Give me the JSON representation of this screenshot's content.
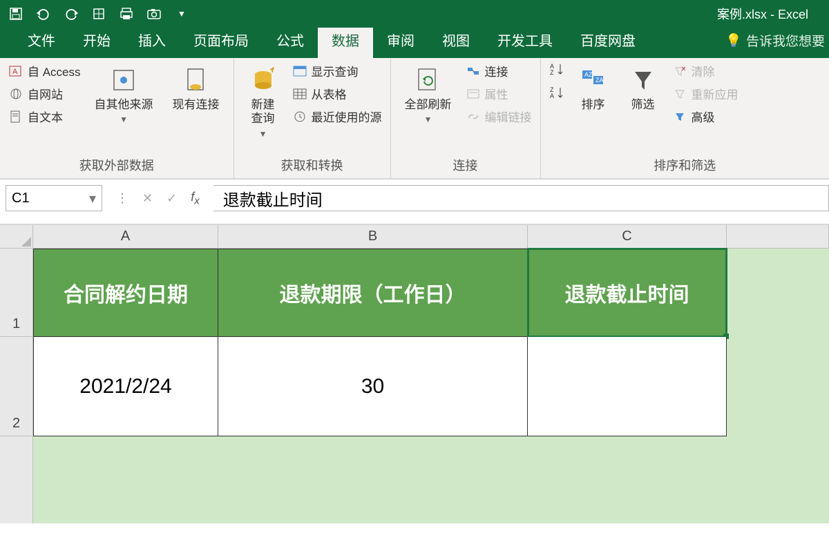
{
  "title": "案例.xlsx - Excel",
  "qat": [
    "save",
    "undo",
    "redo",
    "touch",
    "print",
    "camera"
  ],
  "tabs": {
    "file": "文件",
    "home": "开始",
    "insert": "插入",
    "layout": "页面布局",
    "formulas": "公式",
    "data": "数据",
    "review": "审阅",
    "view": "视图",
    "dev": "开发工具",
    "baidu": "百度网盘",
    "tellme": "告诉我您想要"
  },
  "ribbon": {
    "g1": {
      "label": "获取外部数据",
      "access": "自 Access",
      "web": "自网站",
      "text": "自文本",
      "other": "自其他来源",
      "existing": "现有连接"
    },
    "g2": {
      "label": "获取和转换",
      "newq": "新建\n查询",
      "show": "显示查询",
      "table": "从表格",
      "recent": "最近使用的源"
    },
    "g3": {
      "label": "连接",
      "refresh": "全部刷新",
      "conn": "连接",
      "prop": "属性",
      "links": "编辑链接"
    },
    "g4": {
      "label": "排序和筛选",
      "sort": "排序",
      "filter": "筛选",
      "clear": "清除",
      "reapply": "重新应用",
      "adv": "高级"
    }
  },
  "namebox": "C1",
  "formula": "退款截止时间",
  "columns": [
    "A",
    "B",
    "C"
  ],
  "rows": [
    "1",
    "2"
  ],
  "cells": {
    "A1": "合同解约日期",
    "B1": "退款期限（工作日）",
    "C1": "退款截止时间",
    "A2": "2021/2/24",
    "B2": "30",
    "C2": ""
  },
  "selected": "C1"
}
